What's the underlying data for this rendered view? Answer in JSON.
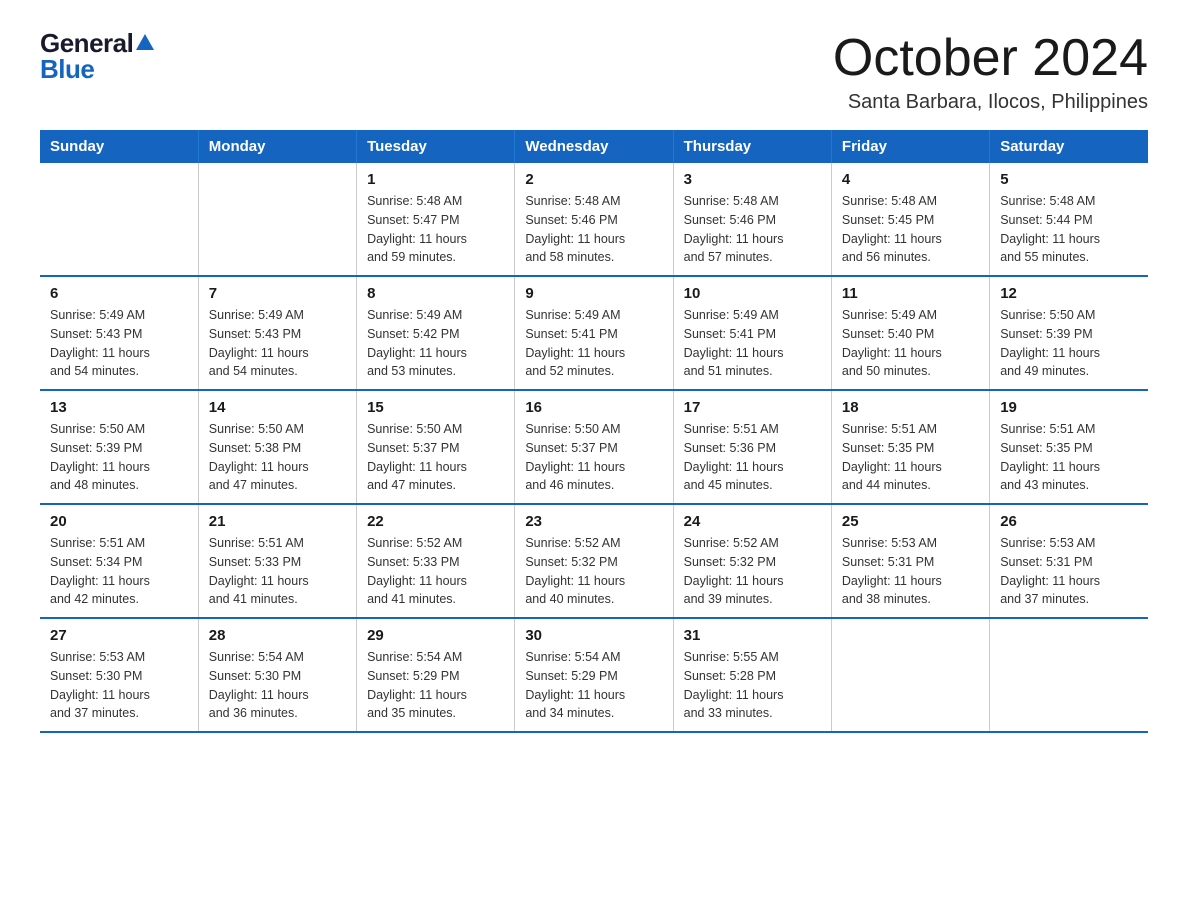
{
  "logo": {
    "general": "General",
    "blue": "Blue"
  },
  "title": "October 2024",
  "location": "Santa Barbara, Ilocos, Philippines",
  "days_of_week": [
    "Sunday",
    "Monday",
    "Tuesday",
    "Wednesday",
    "Thursday",
    "Friday",
    "Saturday"
  ],
  "weeks": [
    [
      {
        "day": "",
        "info": ""
      },
      {
        "day": "",
        "info": ""
      },
      {
        "day": "1",
        "info": "Sunrise: 5:48 AM\nSunset: 5:47 PM\nDaylight: 11 hours\nand 59 minutes."
      },
      {
        "day": "2",
        "info": "Sunrise: 5:48 AM\nSunset: 5:46 PM\nDaylight: 11 hours\nand 58 minutes."
      },
      {
        "day": "3",
        "info": "Sunrise: 5:48 AM\nSunset: 5:46 PM\nDaylight: 11 hours\nand 57 minutes."
      },
      {
        "day": "4",
        "info": "Sunrise: 5:48 AM\nSunset: 5:45 PM\nDaylight: 11 hours\nand 56 minutes."
      },
      {
        "day": "5",
        "info": "Sunrise: 5:48 AM\nSunset: 5:44 PM\nDaylight: 11 hours\nand 55 minutes."
      }
    ],
    [
      {
        "day": "6",
        "info": "Sunrise: 5:49 AM\nSunset: 5:43 PM\nDaylight: 11 hours\nand 54 minutes."
      },
      {
        "day": "7",
        "info": "Sunrise: 5:49 AM\nSunset: 5:43 PM\nDaylight: 11 hours\nand 54 minutes."
      },
      {
        "day": "8",
        "info": "Sunrise: 5:49 AM\nSunset: 5:42 PM\nDaylight: 11 hours\nand 53 minutes."
      },
      {
        "day": "9",
        "info": "Sunrise: 5:49 AM\nSunset: 5:41 PM\nDaylight: 11 hours\nand 52 minutes."
      },
      {
        "day": "10",
        "info": "Sunrise: 5:49 AM\nSunset: 5:41 PM\nDaylight: 11 hours\nand 51 minutes."
      },
      {
        "day": "11",
        "info": "Sunrise: 5:49 AM\nSunset: 5:40 PM\nDaylight: 11 hours\nand 50 minutes."
      },
      {
        "day": "12",
        "info": "Sunrise: 5:50 AM\nSunset: 5:39 PM\nDaylight: 11 hours\nand 49 minutes."
      }
    ],
    [
      {
        "day": "13",
        "info": "Sunrise: 5:50 AM\nSunset: 5:39 PM\nDaylight: 11 hours\nand 48 minutes."
      },
      {
        "day": "14",
        "info": "Sunrise: 5:50 AM\nSunset: 5:38 PM\nDaylight: 11 hours\nand 47 minutes."
      },
      {
        "day": "15",
        "info": "Sunrise: 5:50 AM\nSunset: 5:37 PM\nDaylight: 11 hours\nand 47 minutes."
      },
      {
        "day": "16",
        "info": "Sunrise: 5:50 AM\nSunset: 5:37 PM\nDaylight: 11 hours\nand 46 minutes."
      },
      {
        "day": "17",
        "info": "Sunrise: 5:51 AM\nSunset: 5:36 PM\nDaylight: 11 hours\nand 45 minutes."
      },
      {
        "day": "18",
        "info": "Sunrise: 5:51 AM\nSunset: 5:35 PM\nDaylight: 11 hours\nand 44 minutes."
      },
      {
        "day": "19",
        "info": "Sunrise: 5:51 AM\nSunset: 5:35 PM\nDaylight: 11 hours\nand 43 minutes."
      }
    ],
    [
      {
        "day": "20",
        "info": "Sunrise: 5:51 AM\nSunset: 5:34 PM\nDaylight: 11 hours\nand 42 minutes."
      },
      {
        "day": "21",
        "info": "Sunrise: 5:51 AM\nSunset: 5:33 PM\nDaylight: 11 hours\nand 41 minutes."
      },
      {
        "day": "22",
        "info": "Sunrise: 5:52 AM\nSunset: 5:33 PM\nDaylight: 11 hours\nand 41 minutes."
      },
      {
        "day": "23",
        "info": "Sunrise: 5:52 AM\nSunset: 5:32 PM\nDaylight: 11 hours\nand 40 minutes."
      },
      {
        "day": "24",
        "info": "Sunrise: 5:52 AM\nSunset: 5:32 PM\nDaylight: 11 hours\nand 39 minutes."
      },
      {
        "day": "25",
        "info": "Sunrise: 5:53 AM\nSunset: 5:31 PM\nDaylight: 11 hours\nand 38 minutes."
      },
      {
        "day": "26",
        "info": "Sunrise: 5:53 AM\nSunset: 5:31 PM\nDaylight: 11 hours\nand 37 minutes."
      }
    ],
    [
      {
        "day": "27",
        "info": "Sunrise: 5:53 AM\nSunset: 5:30 PM\nDaylight: 11 hours\nand 37 minutes."
      },
      {
        "day": "28",
        "info": "Sunrise: 5:54 AM\nSunset: 5:30 PM\nDaylight: 11 hours\nand 36 minutes."
      },
      {
        "day": "29",
        "info": "Sunrise: 5:54 AM\nSunset: 5:29 PM\nDaylight: 11 hours\nand 35 minutes."
      },
      {
        "day": "30",
        "info": "Sunrise: 5:54 AM\nSunset: 5:29 PM\nDaylight: 11 hours\nand 34 minutes."
      },
      {
        "day": "31",
        "info": "Sunrise: 5:55 AM\nSunset: 5:28 PM\nDaylight: 11 hours\nand 33 minutes."
      },
      {
        "day": "",
        "info": ""
      },
      {
        "day": "",
        "info": ""
      }
    ]
  ],
  "colors": {
    "header_bg": "#1565c0",
    "header_text": "#ffffff",
    "border_blue": "#1565c0"
  }
}
